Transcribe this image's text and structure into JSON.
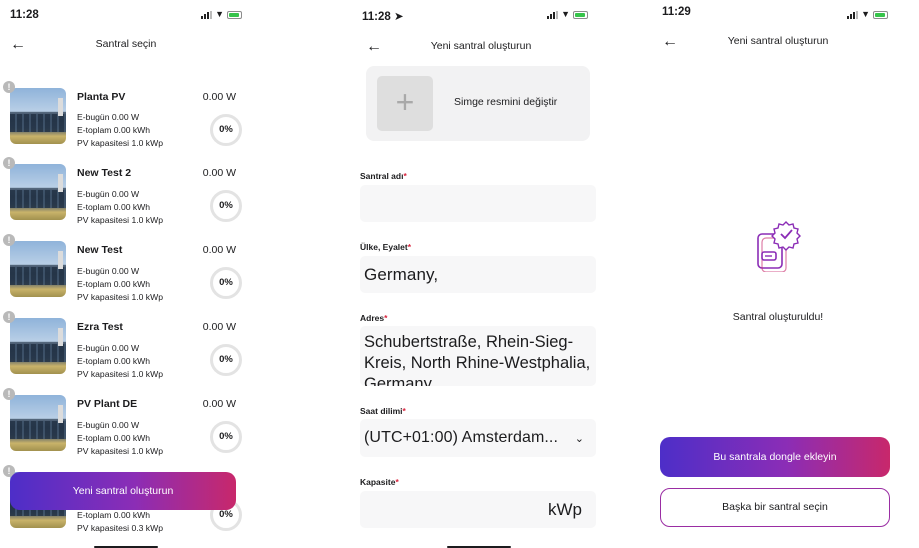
{
  "screen1": {
    "status_time": "11:28",
    "title": "Santral seçin",
    "gauge_percent": "0%",
    "plants": [
      {
        "name": "Planta PV",
        "power": "0.00 W",
        "e_today": "E-bugün 0.00 W",
        "e_total": "E-toplam 0.00 kWh",
        "capacity": "PV kapasitesi 1.0 kWp"
      },
      {
        "name": "New Test 2",
        "power": "0.00 W",
        "e_today": "E-bugün 0.00 W",
        "e_total": "E-toplam 0.00 kWh",
        "capacity": "PV kapasitesi 1.0 kWp"
      },
      {
        "name": "New Test",
        "power": "0.00 W",
        "e_today": "E-bugün 0.00 W",
        "e_total": "E-toplam 0.00 kWh",
        "capacity": "PV kapasitesi 1.0 kWp"
      },
      {
        "name": "Ezra Test",
        "power": "0.00 W",
        "e_today": "E-bugün 0.00 W",
        "e_total": "E-toplam 0.00 kWh",
        "capacity": "PV kapasitesi 1.0 kWp"
      },
      {
        "name": "PV Plant DE",
        "power": "0.00 W",
        "e_today": "E-bugün 0.00 W",
        "e_total": "E-toplam 0.00 kWh",
        "capacity": "PV kapasitesi 1.0 kWp"
      },
      {
        "name": "",
        "power": "",
        "e_today": "",
        "e_total": "E-toplam 0.00 kWh",
        "capacity": "PV kapasitesi 0.3 kWp"
      }
    ],
    "create_button": "Yeni santral oluşturun"
  },
  "screen2": {
    "status_time": "11:28",
    "title": "Yeni santral oluşturun",
    "icon_change_label": "Simge resmini değiştir",
    "fields": {
      "name_label": "Santral adı",
      "name_value": "",
      "country_label": "Ülke, Eyalet",
      "country_value": "Germany,",
      "address_label": "Adres",
      "address_value": "Schubertstraße, Rhein-Sieg-Kreis, North Rhine-Westphalia, Germany",
      "timezone_label": "Saat dilimi",
      "timezone_value": "(UTC+01:00) Amsterdam...",
      "capacity_label": "Kapasite",
      "capacity_unit": "kWp"
    }
  },
  "screen3": {
    "status_time": "11:29",
    "title": "Yeni santral oluşturun",
    "success_message": "Santral oluşturuldu!",
    "primary_button": "Bu santrala dongle ekleyin",
    "secondary_button": "Başka bir santral seçin"
  },
  "colors": {
    "gradient_start": "#4d2ec8",
    "gradient_end": "#c8286b",
    "required": "#d9243d",
    "illustration": "#8b2db6"
  }
}
